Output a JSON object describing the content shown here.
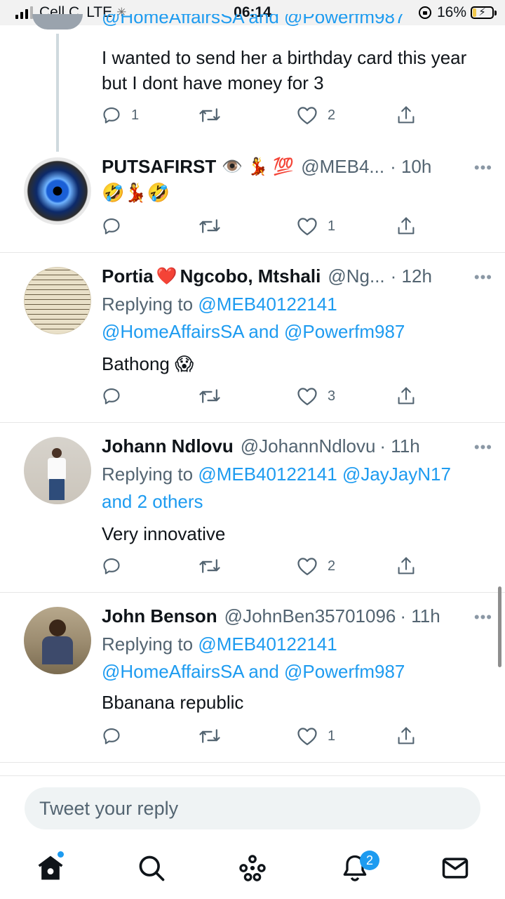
{
  "status_bar": {
    "carrier": "Cell C",
    "network": "LTE",
    "time": "06:14",
    "battery": "16%"
  },
  "partial_tweet": {
    "mentions_line": "@HomeAffairsSA and @Powerfm987",
    "text": "I wanted to send her a birthday card this year but I dont have money for 3",
    "stats": {
      "reply": "1",
      "like": "2"
    }
  },
  "tweets": [
    {
      "name": "PUTSAFIRST",
      "emoji": "👁️ 💃 💯",
      "handle": "@MEB4...",
      "time": "· 10h",
      "text": "🤣💃🤣",
      "stats": {
        "reply": "",
        "like": "1"
      }
    },
    {
      "name": "Portia",
      "name_heart": "❤️",
      "name_rest": "Ngcobo, Mtshali",
      "handle": "@Ng...",
      "time": "· 12h",
      "replying_label": "Replying to",
      "replying_mention": "@MEB40122141",
      "replying_line2": "@HomeAffairsSA and @Powerfm987",
      "text": "Bathong 😱",
      "stats": {
        "reply": "",
        "like": "3"
      }
    },
    {
      "name": "Johann Ndlovu",
      "handle": "@JohannNdlovu",
      "time": "· 11h",
      "replying_label": "Replying to",
      "replying_mention": "@MEB40122141 @JayJayN17",
      "replying_line2": "and 2 others",
      "text": "Very innovative",
      "stats": {
        "reply": "",
        "like": "2"
      }
    },
    {
      "name": "John Benson",
      "handle": "@JohnBen35701096",
      "time": "· 11h",
      "replying_label": "Replying to",
      "replying_mention": "@MEB40122141",
      "replying_line2": "@HomeAffairsSA and @Powerfm987",
      "text": "Bbanana republic",
      "stats": {
        "reply": "",
        "like": "1"
      }
    }
  ],
  "more_glyph": "•••",
  "reply_box": {
    "placeholder": "Tweet your reply"
  },
  "tabbar": {
    "notifications_badge": "2"
  },
  "colors": {
    "accent": "#1d9bf0",
    "secondary_text": "#536471",
    "text": "#0f1419"
  }
}
